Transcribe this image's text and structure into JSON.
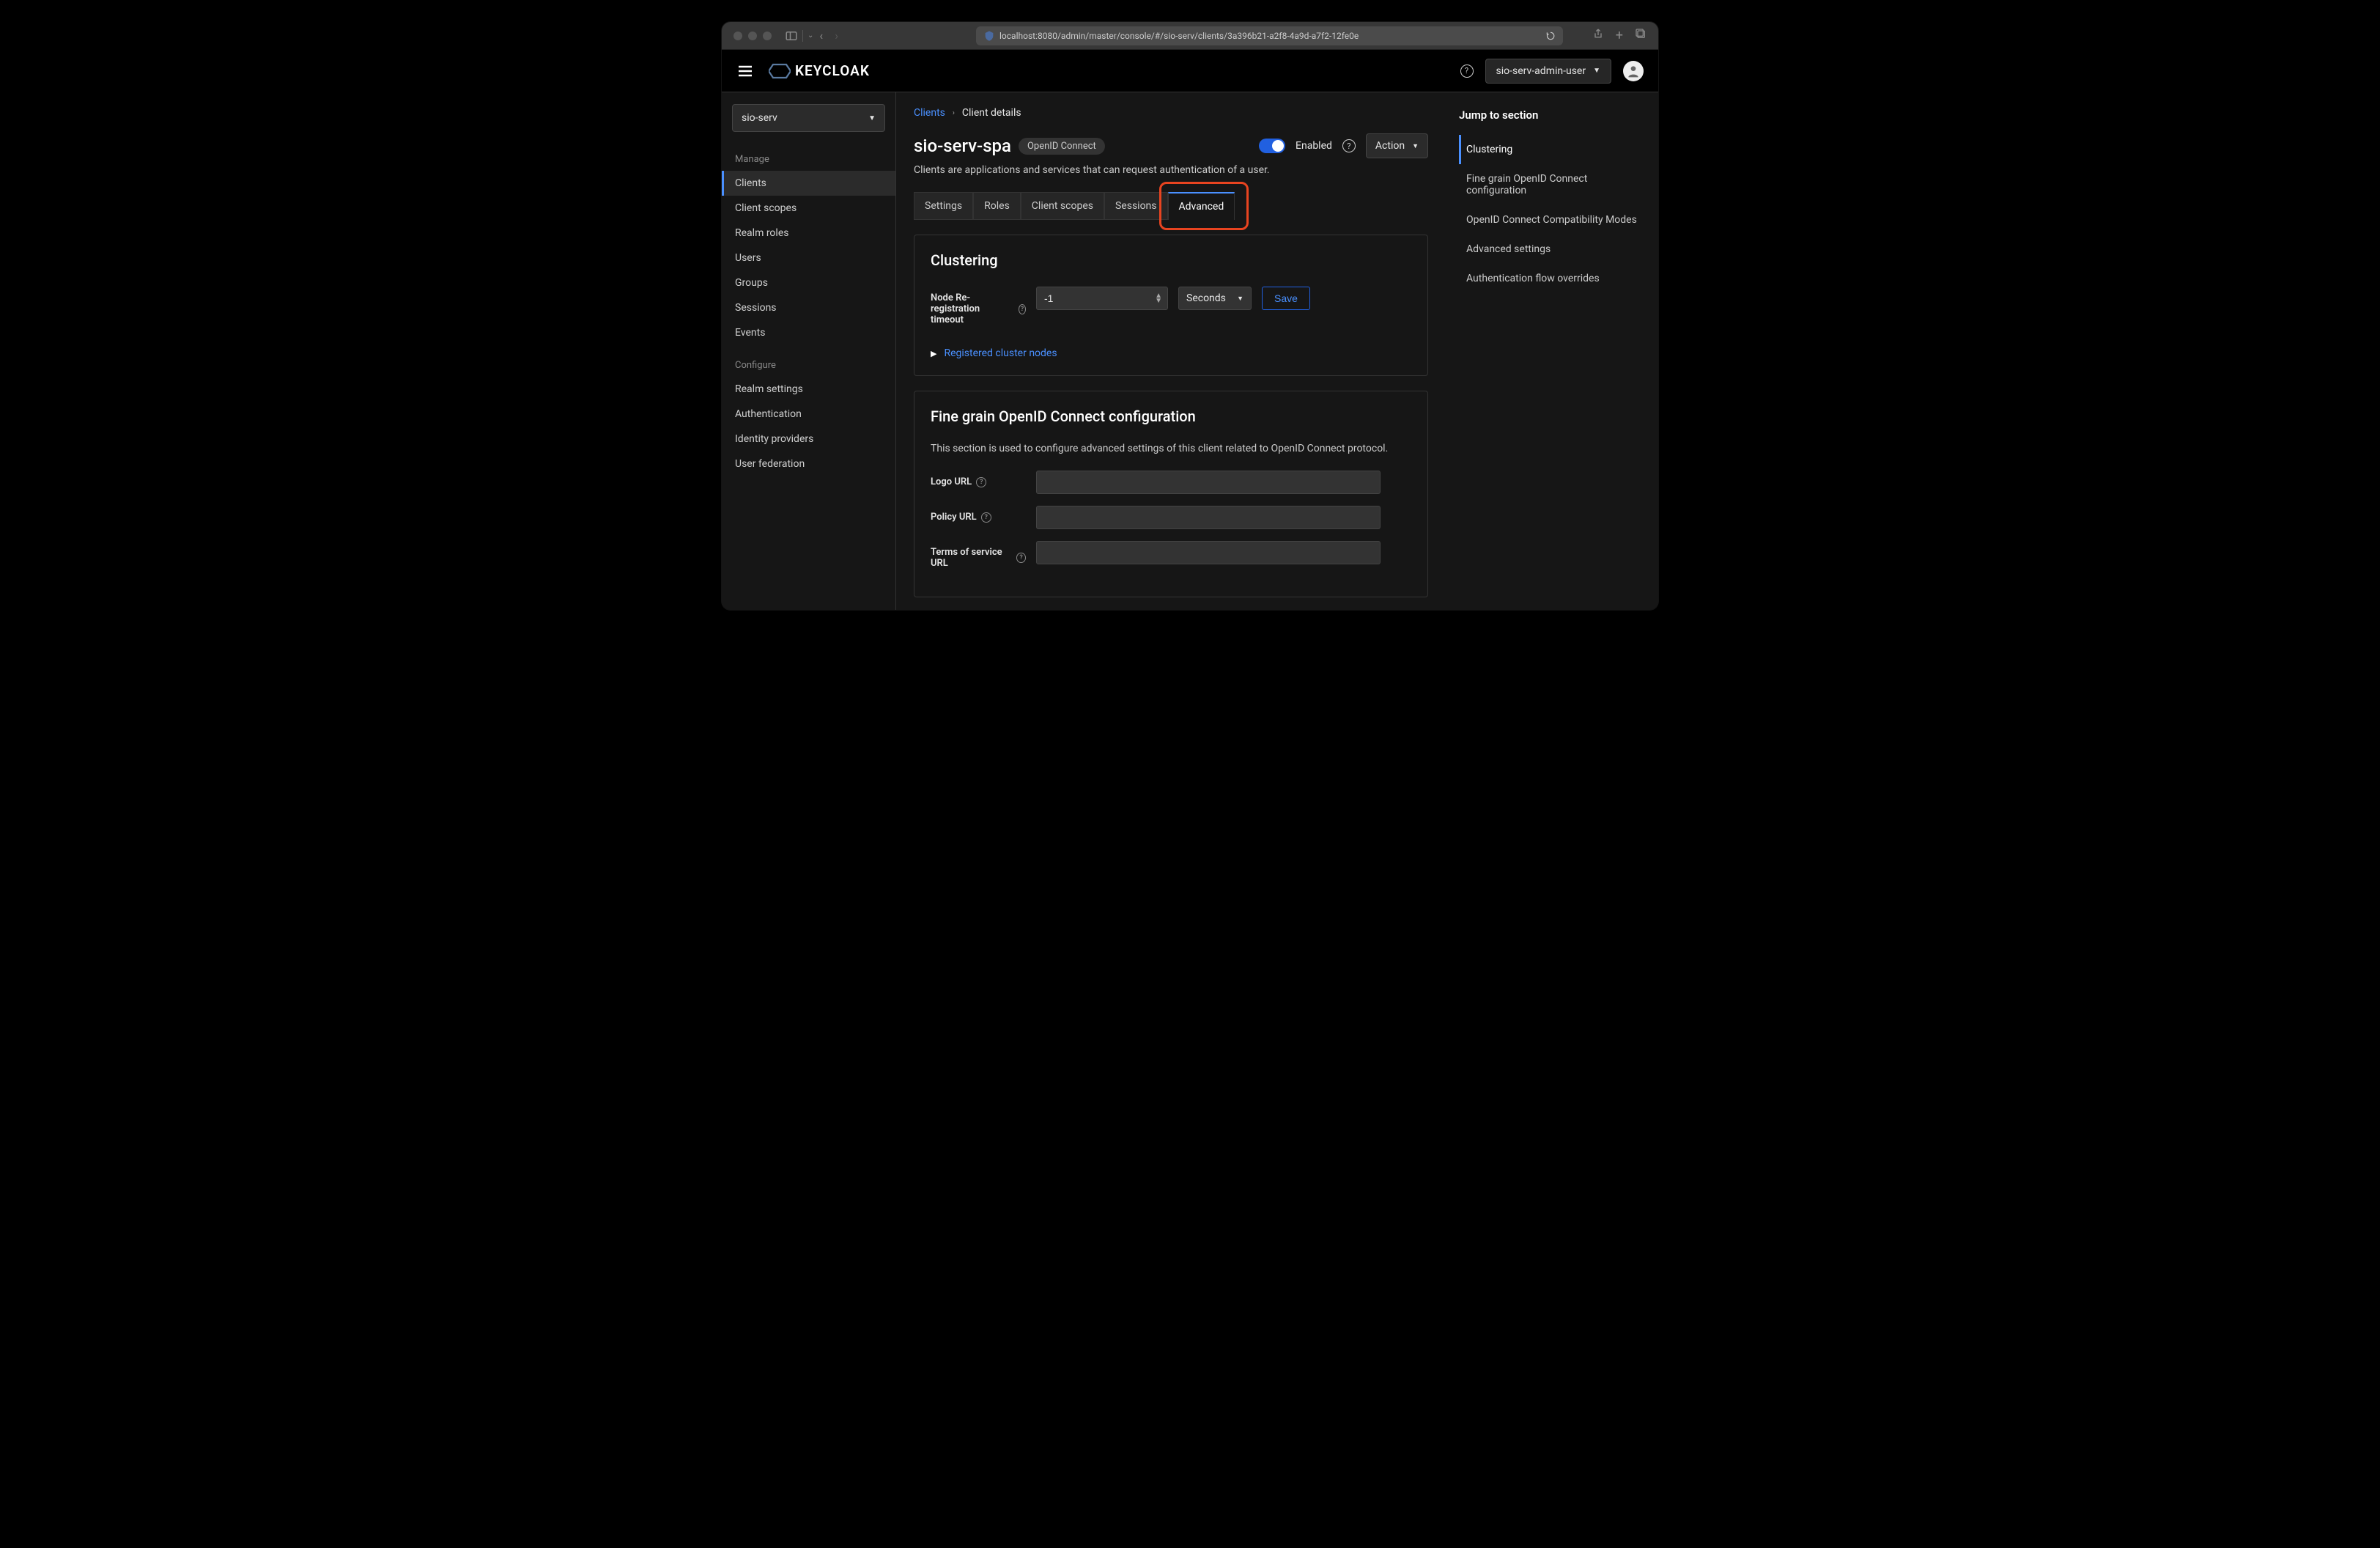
{
  "url": "localhost:8080/admin/master/console/#/sio-serv/clients/3a396b21-a2f8-4a9d-a7f2-12fe0e",
  "app_name": "KEYCLOAK",
  "user_dropdown": "sio-serv-admin-user",
  "realm_selector": "sio-serv",
  "sidebar": {
    "manage_label": "Manage",
    "manage_items": [
      "Clients",
      "Client scopes",
      "Realm roles",
      "Users",
      "Groups",
      "Sessions",
      "Events"
    ],
    "configure_label": "Configure",
    "configure_items": [
      "Realm settings",
      "Authentication",
      "Identity providers",
      "User federation"
    ],
    "active": "Clients"
  },
  "breadcrumb": {
    "parent": "Clients",
    "current": "Client details"
  },
  "page": {
    "title": "sio-serv-spa",
    "protocol_badge": "OpenID Connect",
    "subtitle": "Clients are applications and services that can request authentication of a user.",
    "enabled_label": "Enabled",
    "action_label": "Action"
  },
  "tabs": [
    "Settings",
    "Roles",
    "Client scopes",
    "Sessions",
    "Advanced"
  ],
  "active_tab": "Advanced",
  "clustering": {
    "heading": "Clustering",
    "field_label": "Node Re-registration timeout",
    "value": "-1",
    "unit_options": "Seconds",
    "save_label": "Save",
    "expand_label": "Registered cluster nodes"
  },
  "oidc": {
    "heading": "Fine grain OpenID Connect configuration",
    "desc": "This section is used to configure advanced settings of this client related to OpenID Connect protocol.",
    "logo_label": "Logo URL",
    "policy_label": "Policy URL",
    "tos_label": "Terms of service URL"
  },
  "jump": {
    "title": "Jump to section",
    "items": [
      "Clustering",
      "Fine grain OpenID Connect configuration",
      "OpenID Connect Compatibility Modes",
      "Advanced settings",
      "Authentication flow overrides"
    ],
    "active": "Clustering"
  }
}
